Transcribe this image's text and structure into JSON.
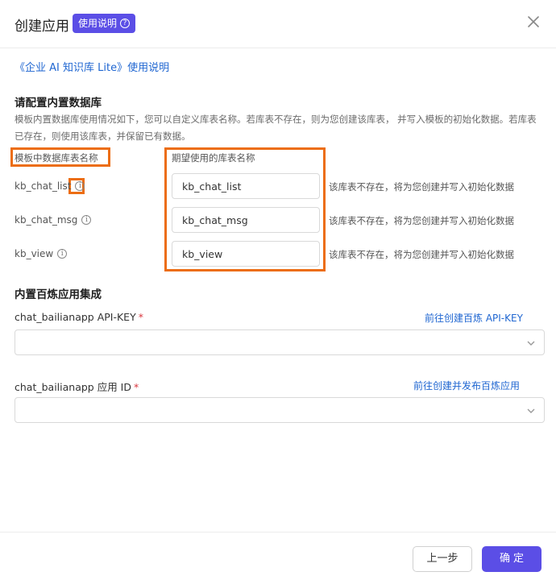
{
  "dialog": {
    "title": "创建应用",
    "help_badge": "使用说明",
    "help_badge_icon": "question-circle-icon",
    "close_icon": "close-icon"
  },
  "doc_link": "《企业 AI 知识库 Lite》使用说明",
  "db_section": {
    "title": "请配置内置数据库",
    "description": "模板内置数据库使用情况如下，您可以自定义库表名称。若库表不存在，则为您创建该库表， 并写入模板的初始化数据。若库表已存在，则使用该库表，并保留已有数据。",
    "col_template": "模板中数据库表名称",
    "col_expected": "期望使用的库表名称",
    "rows": [
      {
        "name": "kb_chat_list",
        "value": "kb_chat_list",
        "status": "该库表不存在，将为您创建并写入初始化数据"
      },
      {
        "name": "kb_chat_msg",
        "value": "kb_chat_msg",
        "status": "该库表不存在，将为您创建并写入初始化数据"
      },
      {
        "name": "kb_view",
        "value": "kb_view",
        "status": "该库表不存在，将为您创建并写入初始化数据"
      }
    ]
  },
  "app_section": {
    "title": "内置百炼应用集成",
    "api_key_label": "chat_bailianapp API-KEY",
    "api_key_link": "前往创建百炼 API-KEY",
    "app_id_label": "chat_bailianapp 应用 ID",
    "app_id_link": "前往创建并发布百炼应用",
    "required_mark": "*"
  },
  "footer": {
    "prev_label": "上一步",
    "ok_label": "确定"
  },
  "colors": {
    "accent": "#5b4ee6",
    "link": "#1f66d1",
    "highlight": "#ec6d13",
    "required": "#d9363e"
  }
}
